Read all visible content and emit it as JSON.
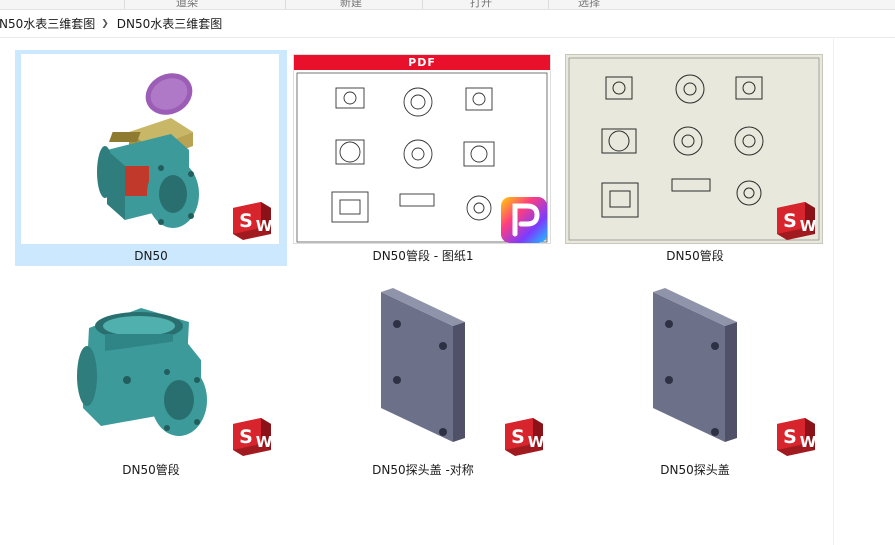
{
  "toolbar_strip": {
    "segments": [
      "道染",
      "新建",
      "打开",
      "选择"
    ]
  },
  "breadcrumb": {
    "items": [
      "N50水表三维套图",
      "DN50水表三维套图"
    ]
  },
  "files": [
    {
      "name": "DN50",
      "type": "solidworks-assembly",
      "selected": true,
      "badge": "SW"
    },
    {
      "name": "DN50管段 - 图纸1",
      "type": "pdf-drawing",
      "selected": false,
      "badge": "PDF",
      "header": "PDF"
    },
    {
      "name": "DN50管段",
      "type": "solidworks-drawing",
      "selected": false,
      "badge": "SW"
    },
    {
      "name": "DN50管段",
      "type": "solidworks-part",
      "selected": false,
      "badge": "SW"
    },
    {
      "name": "DN50探头盖 -对称",
      "type": "solidworks-part",
      "selected": false,
      "badge": "SW"
    },
    {
      "name": "DN50探头盖",
      "type": "solidworks-part",
      "selected": false,
      "badge": "SW"
    }
  ],
  "colors": {
    "selection": "#cce8ff",
    "teal": "#3d9a9a",
    "purple": "#9b5db5",
    "grey_part": "#6c7088",
    "sw_red": "#d8242c",
    "pdf_red": "#e8102a"
  }
}
